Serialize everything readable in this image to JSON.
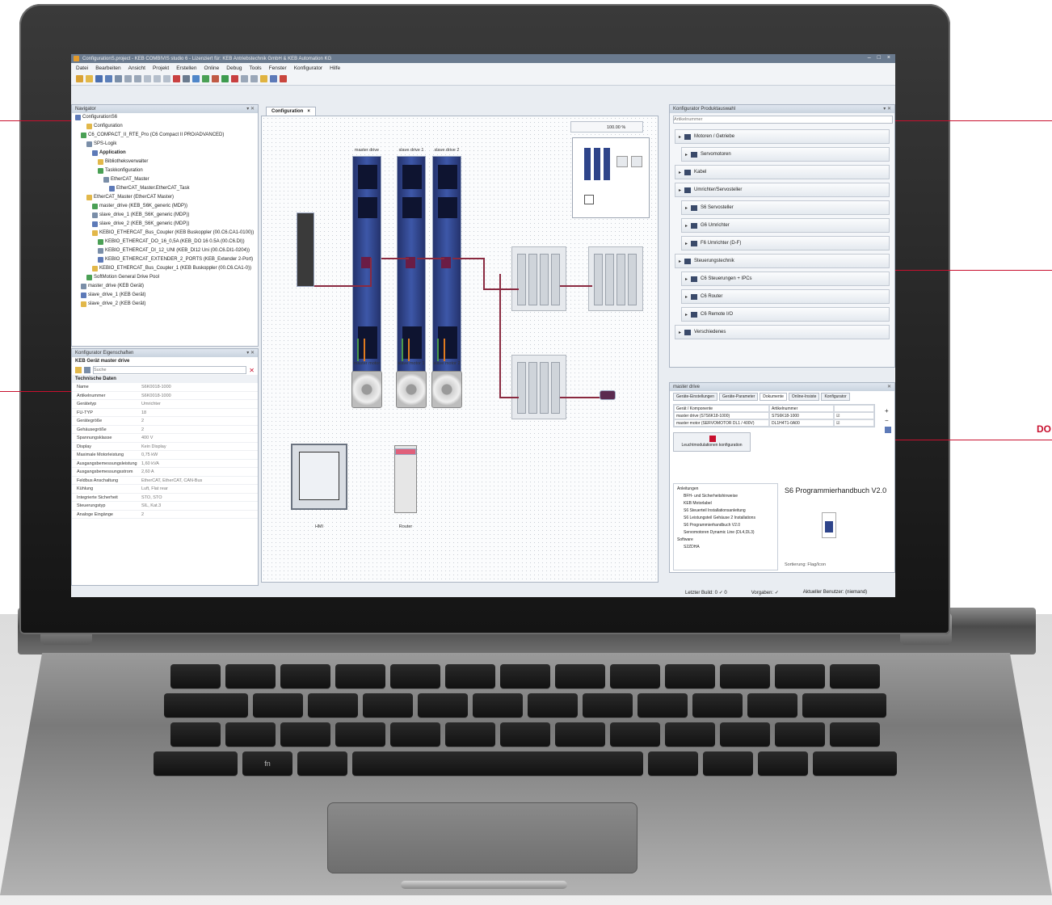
{
  "window": {
    "title": "ConfigurationS.project - KEB COMBIVIS studio 6 - Lizenziert für: KEB Antriebstechnik GmbH & KEB Automation KG",
    "controls": [
      "–",
      "□",
      "×"
    ]
  },
  "menu": [
    "Datei",
    "Bearbeiten",
    "Ansicht",
    "Projekt",
    "Erstellen",
    "Online",
    "Debug",
    "Tools",
    "Fenster",
    "Konfigurator",
    "Hilfe"
  ],
  "left_panel": {
    "title": "Navigator",
    "tree": [
      {
        "label": "ConfigurationS6",
        "indent": 0,
        "bold": false
      },
      {
        "label": "Configuration",
        "indent": 2,
        "bold": false
      },
      {
        "label": "C6_COMPACT_II_RTE_Pro (C6 Compact II PRO/ADVANCED)",
        "indent": 1,
        "bold": false
      },
      {
        "label": "SPS-Logik",
        "indent": 2,
        "bold": false
      },
      {
        "label": "Application",
        "indent": 3,
        "bold": true
      },
      {
        "label": "Bibliotheksverwalter",
        "indent": 4,
        "bold": false
      },
      {
        "label": "Taskkonfiguration",
        "indent": 4,
        "bold": false
      },
      {
        "label": "EtherCAT_Master",
        "indent": 5,
        "bold": false
      },
      {
        "label": "EtherCAT_Master.EtherCAT_Task",
        "indent": 6,
        "bold": false
      },
      {
        "label": "EtherCAT_Master (EtherCAT Master)",
        "indent": 2,
        "bold": false
      },
      {
        "label": "master_drive (KEB_S6K_generic (MDP))",
        "indent": 3,
        "bold": false
      },
      {
        "label": "slave_drive_1 (KEB_S6K_generic (MDP))",
        "indent": 3,
        "bold": false
      },
      {
        "label": "slave_drive_2 (KEB_S6K_generic (MDP))",
        "indent": 3,
        "bold": false
      },
      {
        "label": "KEBIO_ETHERCAT_Bus_Coupler (KEB Buskoppler (00.C6.CA1-0100))",
        "indent": 3,
        "bold": false
      },
      {
        "label": "KEBIO_ETHERCAT_DO_16_0,5A (KEB_DO 16 0.5A (00.C6.DI))",
        "indent": 4,
        "bold": false
      },
      {
        "label": "KEBIO_ETHERCAT_DI_12_UNI (KEB_DI12 Uni (00.C6.DI1-0204))",
        "indent": 4,
        "bold": false
      },
      {
        "label": "KEBIO_ETHERCAT_EXTENDER_2_PORTS (KEB_Extender 2-Port)",
        "indent": 4,
        "bold": false
      },
      {
        "label": "KEBIO_ETHERCAT_Bus_Coupler_1 (KEB Buskoppler (00.C6.CA1-0))",
        "indent": 3,
        "bold": false
      },
      {
        "label": "SoftMotion General Drive Pool",
        "indent": 2,
        "bold": false
      },
      {
        "label": "master_drive (KEB Gerät)",
        "indent": 1,
        "bold": false
      },
      {
        "label": "slave_drive_1 (KEB Gerät)",
        "indent": 1,
        "bold": false
      },
      {
        "label": "slave_drive_2 (KEB Gerät)",
        "indent": 1,
        "bold": false
      }
    ]
  },
  "props_panel": {
    "title": "Konfigurator Eigenschaften",
    "subtitle": "KEB Gerät master drive",
    "search_placeholder": "Suche",
    "section": "Technische Daten",
    "rows": [
      {
        "k": "Name",
        "v": "S6K0018-1000"
      },
      {
        "k": "Artikelnummer",
        "v": "S6K0018-1000"
      },
      {
        "k": "Gerätetyp",
        "v": "Umrichter"
      },
      {
        "k": "FU-TYP",
        "v": "18"
      },
      {
        "k": "Gerätegröße",
        "v": "2"
      },
      {
        "k": "Gehäusegröße",
        "v": "2"
      },
      {
        "k": "Spannungsklasse",
        "v": "400 V"
      },
      {
        "k": "Display",
        "v": "Kein Display"
      },
      {
        "k": "Maximale Motorleistung",
        "v": "0,75 kW"
      },
      {
        "k": "Ausgangsbemessungsleistung",
        "v": "1,60 kVA"
      },
      {
        "k": "Ausgangsbemessungsstrom",
        "v": "2,60 A"
      },
      {
        "k": "Feldbus Anschaltung",
        "v": "EtherCAT, EtherCAT, CAN-Bus"
      },
      {
        "k": "Kühlung",
        "v": "Luft, Flat rear"
      },
      {
        "k": "Integrierte Sicherheit",
        "v": "STO, STO"
      },
      {
        "k": "Steuerungstyp",
        "v": "SIL, Kat.3"
      },
      {
        "k": "Analoge Eingänge",
        "v": "2"
      }
    ]
  },
  "center": {
    "tab_label": "Configuration",
    "tab_close": "×",
    "zoom_value": "100.00 %",
    "drives": [
      "master drive",
      "slave drive 1",
      "slave drive 2"
    ],
    "motors": [
      "master motor",
      "slave motor 1",
      "slave motor 2"
    ],
    "hmi_label": "HMI",
    "router_label": "Router"
  },
  "right_panel": {
    "title": "Konfigurator Produktauswahl",
    "search_placeholder": "Artikelnummer",
    "categories": [
      {
        "label": "Motoren / Getriebe",
        "sub": false
      },
      {
        "label": "Servomotoren",
        "sub": true
      },
      {
        "label": "Kabel",
        "sub": false
      },
      {
        "label": "Umrichter/Servosteller",
        "sub": false
      },
      {
        "label": "S6 Servosteller",
        "sub": true
      },
      {
        "label": "G6 Umrichter",
        "sub": true
      },
      {
        "label": "F6 Umrichter (D-F)",
        "sub": true
      },
      {
        "label": "Steuerungstechnik",
        "sub": false
      },
      {
        "label": "C6 Steuerungen + IPCs",
        "sub": true
      },
      {
        "label": "C6 Router",
        "sub": true
      },
      {
        "label": "C6 Remote I/O",
        "sub": true
      },
      {
        "label": "Verschiedenes",
        "sub": false
      }
    ]
  },
  "detail": {
    "title": "master drive",
    "tabs": [
      "Geräte-Einstellungen",
      "Geräte-Parameter",
      "Dokumente",
      "Online-Insiste",
      "Konfigurator"
    ],
    "grid_headers": [
      "Gerät / Komponente",
      "Artikelnummer"
    ],
    "grid_rows": [
      {
        "component": "master drive (S7S6K18-1000)",
        "article": "S7S6K18-1000"
      },
      {
        "component": "master motor (SERVOMOTOR DL1 / 400V)",
        "article": "DL1H4T1-0A00"
      }
    ],
    "config_button": "Leuchtmodulationen konfiguration",
    "doc_tree": [
      "Anleitungen",
      "BFH- und Sicherheitshinweise",
      "KEB Motorlabel",
      "S6 Steuerteil Installationsanleitung",
      "S6 Leistungsteil Gehäuse 2 Installations",
      "S6 Programmierhandbuch V2.0",
      "Servomotoren Dynamic Line (DL4,DL3)",
      "Software",
      "S2ZDHA"
    ],
    "doc_title": "S6 Programmierhandbuch V2.0",
    "doc_footer": "Sortierung: Flag/Icon"
  },
  "status": {
    "left": "Letzter Build: 0 ✓ 0",
    "middle": "Vorgaben: ✓",
    "right": "Aktueller Benutzer: (niemand)"
  },
  "callout": {
    "label": "DO"
  },
  "colors": {
    "accent": "#c8102e",
    "drive": "#2e448a",
    "wire": "#8a2a40"
  }
}
